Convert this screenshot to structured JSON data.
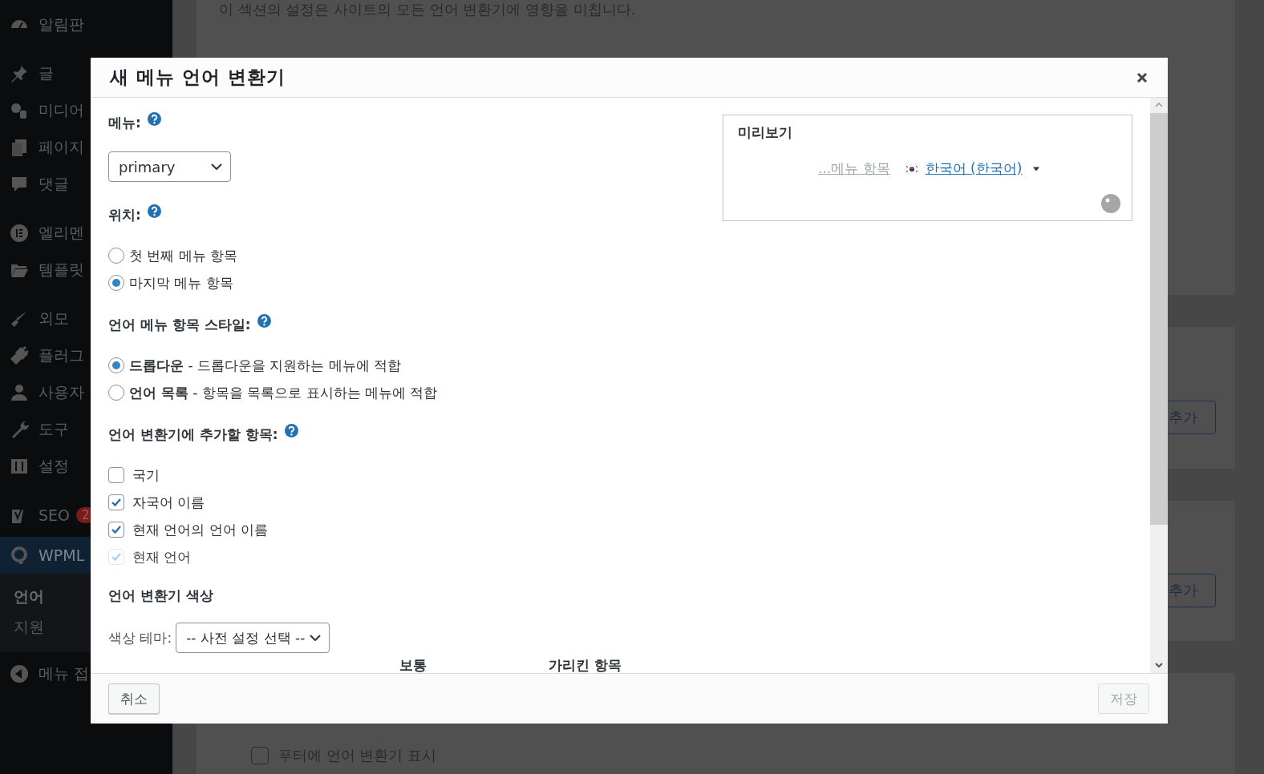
{
  "sidebar": {
    "groups": [
      {
        "items": [
          {
            "label": "알림판",
            "selected": false
          }
        ]
      },
      {
        "items": [
          {
            "label": "글",
            "selected": false
          },
          {
            "label": "미디어",
            "selected": false
          },
          {
            "label": "페이지",
            "selected": false
          },
          {
            "label": "댓글",
            "selected": false
          }
        ]
      },
      {
        "items": [
          {
            "label": "엘리멘",
            "selected": false
          },
          {
            "label": "템플릿",
            "selected": false
          }
        ]
      },
      {
        "items": [
          {
            "label": "외모",
            "selected": false
          },
          {
            "label": "플러그",
            "selected": false
          },
          {
            "label": "사용자",
            "selected": false
          },
          {
            "label": "도구",
            "selected": false
          },
          {
            "label": "설정",
            "selected": false
          }
        ]
      },
      {
        "items": [
          {
            "label": "SEO",
            "selected": false,
            "badge": "2"
          },
          {
            "label": "WPML",
            "selected": true,
            "children": [
              {
                "label": "언어",
                "selected": true
              },
              {
                "label": "지원",
                "selected": false
              }
            ]
          }
        ]
      }
    ],
    "collapse_label": "메뉴 접"
  },
  "page": {
    "description": "이 섹션의 설정은 사이트의 모든 언어 변환기에 영향을 미칩니다.",
    "add_buttons": [
      "추가",
      "추가"
    ],
    "footer_option": {
      "label": "푸터에 언어 변환기 표시",
      "checked": false
    }
  },
  "dialog": {
    "title": "새 메뉴 언어 변환기",
    "menu": {
      "label": "메뉴:",
      "value": "primary"
    },
    "position": {
      "label": "위치:",
      "options": [
        {
          "label": "첫 번째 메뉴 항목",
          "selected": false
        },
        {
          "label": "마지막 메뉴 항목",
          "selected": true
        }
      ]
    },
    "style": {
      "label": "언어 메뉴 항목 스타일:",
      "options": [
        {
          "label": "**드롭다운** - 드롭다운을 지원하는 메뉴에 적합",
          "selected": true
        },
        {
          "label": "**언어 목록** - 항목을 목록으로 표시하는 메뉴에 적합",
          "selected": false
        }
      ]
    },
    "items": {
      "label": "언어 변환기에 추가할 항목:",
      "options": [
        {
          "label": "국기",
          "checked": false,
          "disabled": false
        },
        {
          "label": "자국어 이름",
          "checked": true,
          "disabled": false
        },
        {
          "label": "현재 언어의 언어 이름",
          "checked": true,
          "disabled": false
        },
        {
          "label": "현재 언어",
          "checked": true,
          "disabled": true
        }
      ]
    },
    "colors": {
      "heading": "언어 변환기 색상",
      "theme_label": "색상 테마:",
      "theme_value": "-- 사전 설정 선택 --",
      "columns": [
        "보통",
        "가리킨 항목"
      ]
    },
    "preview": {
      "title": "미리보기",
      "menu_item": "...메뉴 항목",
      "language": "한국어 (한국어)"
    },
    "cancel": "취소",
    "save": {
      "label": "저장",
      "disabled": true
    }
  }
}
